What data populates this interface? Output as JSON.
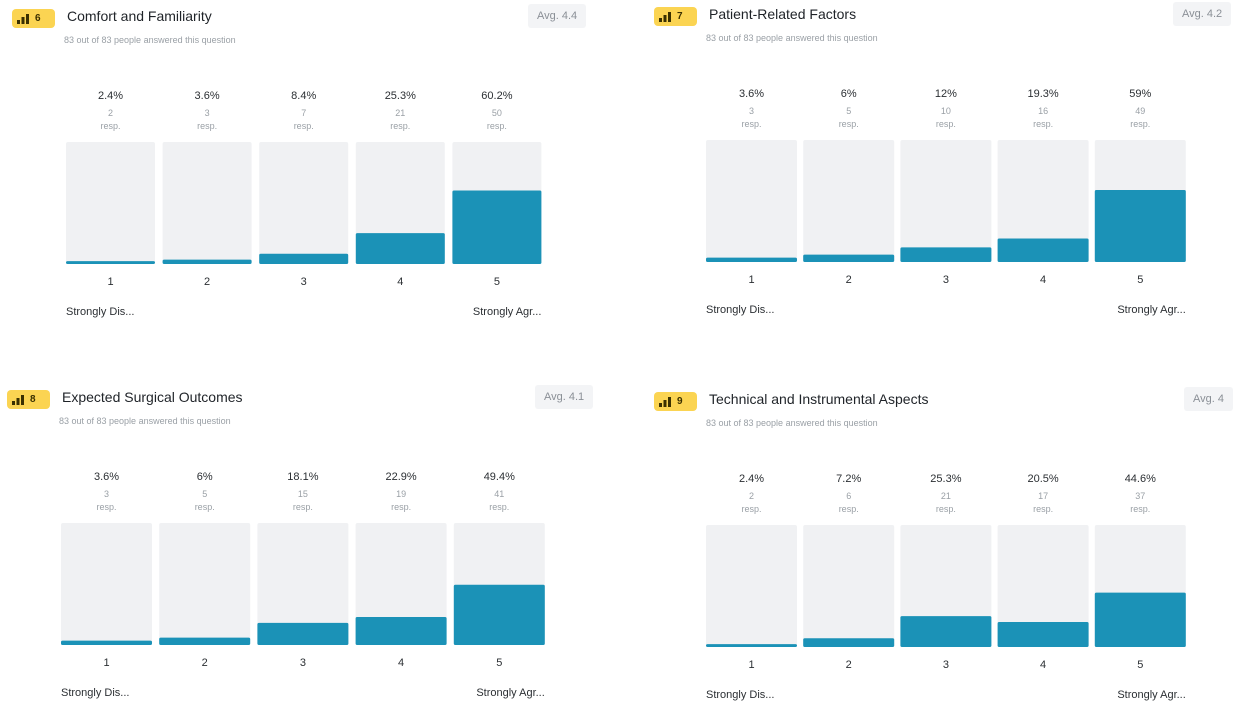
{
  "colors": {
    "bar_fill": "#1b92b7",
    "bar_track": "#f0f1f3",
    "badge_bg": "#fbd452",
    "badge_icon": "#3a3000"
  },
  "badge_icon": "bar-chart-icon",
  "questions": [
    {
      "number": "6",
      "title": "Comfort and Familiarity",
      "avg_label": "Avg. 4.4",
      "answered_text": "83 out of 83 people answered this question",
      "resp_unit": "resp.",
      "low_label": "Strongly Dis...",
      "high_label": "Strongly Agr...",
      "chart_data": {
        "type": "bar",
        "categories": [
          "1",
          "2",
          "3",
          "4",
          "5"
        ],
        "values": [
          2.4,
          3.6,
          8.4,
          25.3,
          60.2
        ],
        "percent_labels": [
          "2.4%",
          "3.6%",
          "8.4%",
          "25.3%",
          "60.2%"
        ],
        "counts": [
          "2",
          "3",
          "7",
          "21",
          "50"
        ],
        "ylim": [
          0,
          100
        ]
      }
    },
    {
      "number": "7",
      "title": "Patient-Related Factors",
      "avg_label": "Avg. 4.2",
      "answered_text": "83 out of 83 people answered this question",
      "resp_unit": "resp.",
      "low_label": "Strongly Dis...",
      "high_label": "Strongly Agr...",
      "chart_data": {
        "type": "bar",
        "categories": [
          "1",
          "2",
          "3",
          "4",
          "5"
        ],
        "values": [
          3.6,
          6,
          12,
          19.3,
          59
        ],
        "percent_labels": [
          "3.6%",
          "6%",
          "12%",
          "19.3%",
          "59%"
        ],
        "counts": [
          "3",
          "5",
          "10",
          "16",
          "49"
        ],
        "ylim": [
          0,
          100
        ]
      }
    },
    {
      "number": "8",
      "title": "Expected Surgical Outcomes",
      "avg_label": "Avg. 4.1",
      "answered_text": "83 out of 83 people answered this question",
      "resp_unit": "resp.",
      "low_label": "Strongly Dis...",
      "high_label": "Strongly Agr...",
      "chart_data": {
        "type": "bar",
        "categories": [
          "1",
          "2",
          "3",
          "4",
          "5"
        ],
        "values": [
          3.6,
          6,
          18.1,
          22.9,
          49.4
        ],
        "percent_labels": [
          "3.6%",
          "6%",
          "18.1%",
          "22.9%",
          "49.4%"
        ],
        "counts": [
          "3",
          "5",
          "15",
          "19",
          "41"
        ],
        "ylim": [
          0,
          100
        ]
      }
    },
    {
      "number": "9",
      "title": "Technical and Instrumental Aspects",
      "avg_label": "Avg. 4",
      "answered_text": "83 out of 83 people answered this question",
      "resp_unit": "resp.",
      "low_label": "Strongly Dis...",
      "high_label": "Strongly Agr...",
      "chart_data": {
        "type": "bar",
        "categories": [
          "1",
          "2",
          "3",
          "4",
          "5"
        ],
        "values": [
          2.4,
          7.2,
          25.3,
          20.5,
          44.6
        ],
        "percent_labels": [
          "2.4%",
          "7.2%",
          "25.3%",
          "20.5%",
          "44.6%"
        ],
        "counts": [
          "2",
          "6",
          "21",
          "17",
          "37"
        ],
        "ylim": [
          0,
          100
        ]
      }
    }
  ]
}
